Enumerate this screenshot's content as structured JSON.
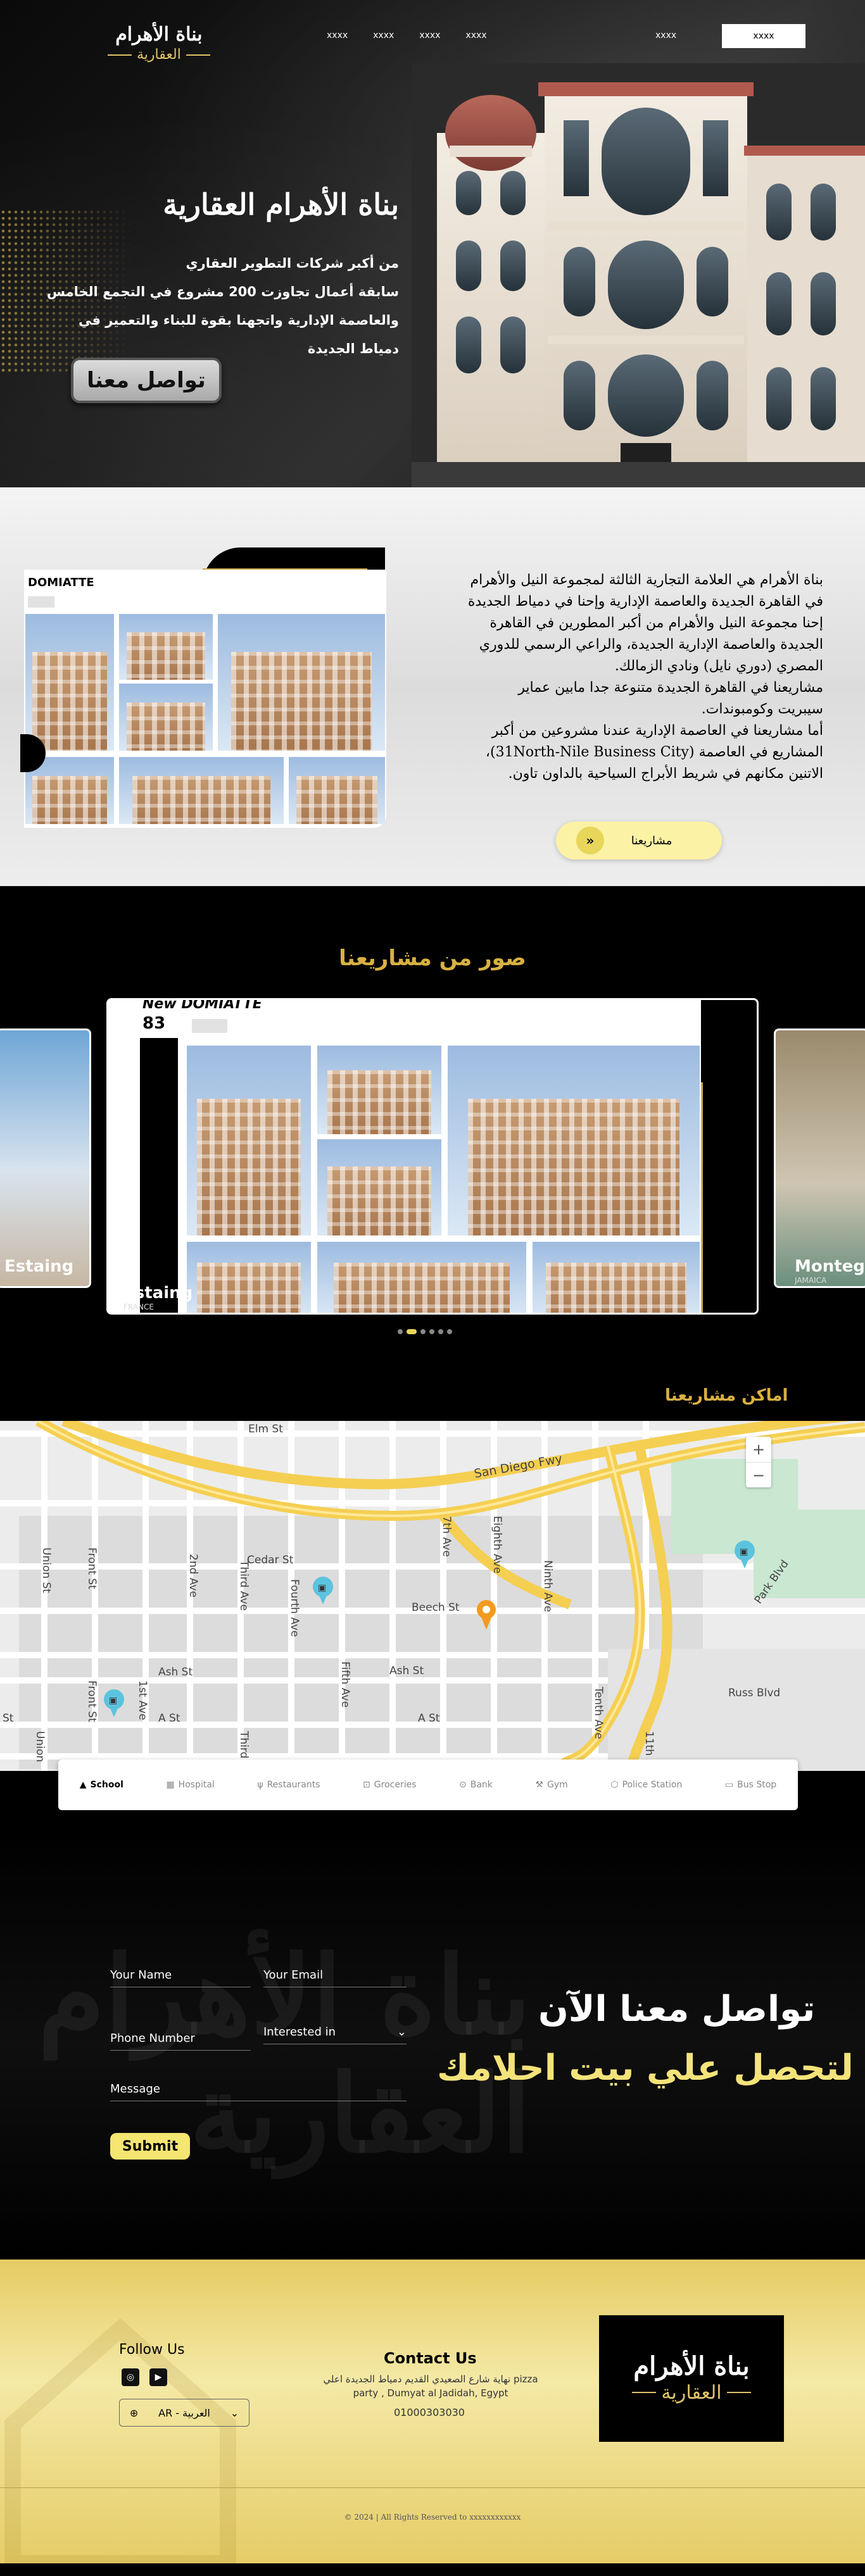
{
  "brand": {
    "name_line1": "بناة الأهرام",
    "name_line2": "العقارية"
  },
  "nav": {
    "links": [
      "xxxx",
      "xxxx",
      "xxxx",
      "xxxx"
    ],
    "login": "xxxx",
    "cta": "xxxx"
  },
  "hero": {
    "title": "بناة الأهرام العقارية",
    "desc_lines": [
      "من أكبر شركات التطوير العقاري",
      "سابقة أعمال تجاوزت 200 مشروع في التجمع الخامس",
      "والعاصمة الإدارية واتجهنا بقوة للبناء والتعمير في",
      "دمياط الجديدة"
    ],
    "cta": "تواصل معنا"
  },
  "about": {
    "collage_label": "DOMIATTE",
    "lines": [
      "بناة الأهرام هي العلامة التجارية الثالثة لمجموعة النيل والأهرام",
      "في القاهرة الجديدة والعاصمة الإدارية وإحنا في دمياط الجديدة",
      "إحنا مجموعة النيل والأهرام من أكبر المطورين في القاهرة",
      "الجديدة والعاصمة الإدارية الجديدة، والراعي الرسمي للدوري",
      "المصري (دوري نايل) ونادي الزمالك.",
      " مشاريعنا في القاهرة الجديدة متنوعة جدا مابين عماير",
      "سيبريت وكومبوندات.",
      "أما مشاريعنا في العاصمة الإدارية عندنا مشروعين من أكبر",
      "المشاريع في العاصمة (31North-Nile Business City)،",
      "الاتنين مكانهم في شريط الأبراج السياحية بالداون تاون."
    ],
    "button": "مشاريعنا",
    "chevron_icon": "chevrons-down-icon"
  },
  "gallery": {
    "title": "صور من مشاريعنا",
    "main_label_top": "New DOMIATTE",
    "main_number": "83",
    "left_caption": "Estaing",
    "left_sub": "FRANCE",
    "right_caption": "Montego",
    "right_sub": "JAMAICA",
    "dot_count": 6,
    "active_dot": 1
  },
  "map": {
    "title": "اماكن مشاريعنا",
    "streets": [
      "Elm St",
      "San Diego Fwy",
      "Union St",
      "Front St",
      "2nd Ave",
      "Third Ave",
      "Cedar St",
      "Fourth Ave",
      "7th Ave",
      "Eighth Ave",
      "Ninth Ave",
      "Beech St",
      "Fifth Ave",
      "Ash St",
      "Ash St",
      "Tenth Ave",
      "Russ Blvd",
      "Park Blvd",
      "A St",
      "A St",
      "1st Ave",
      "11th A",
      "Front St",
      "Third",
      "Union",
      "St"
    ],
    "zoom_in": "+",
    "zoom_out": "−",
    "poi_tabs": [
      {
        "label": "School",
        "icon": "school-icon"
      },
      {
        "label": "Hospital",
        "icon": "hospital-icon"
      },
      {
        "label": "Restaurants",
        "icon": "restaurant-icon"
      },
      {
        "label": "Groceries",
        "icon": "cart-icon"
      },
      {
        "label": "Bank",
        "icon": "bank-icon"
      },
      {
        "label": "Gym",
        "icon": "dumbbell-icon"
      },
      {
        "label": "Police Station",
        "icon": "shield-icon"
      },
      {
        "label": "Bus Stop",
        "icon": "bus-icon"
      }
    ],
    "active_tab": "School"
  },
  "contact": {
    "title1": "تواصل معنا الآن",
    "title2": "لتحصل علي بيت احلامك",
    "fields": {
      "name": "Your Name",
      "email": "Your Email",
      "phone": "Phone Number",
      "interest": "Interested in",
      "message": "Message"
    },
    "submit": "Submit"
  },
  "footer": {
    "follow": "Follow Us",
    "language": "AR - العربية",
    "contact_title": "Contact Us",
    "address": "نهاية شارع الصعيدي القديم دمياط الجديدة اعلي pizza party , Dumyat al Jadidah, Egypt",
    "phone": "01000303030",
    "copyright": "© 2024 | All Rights Reserved to xxxxxxxxxxxx"
  },
  "colors": {
    "gold": "#d8b142",
    "pale_yellow": "#f5e571",
    "black": "#000000"
  }
}
